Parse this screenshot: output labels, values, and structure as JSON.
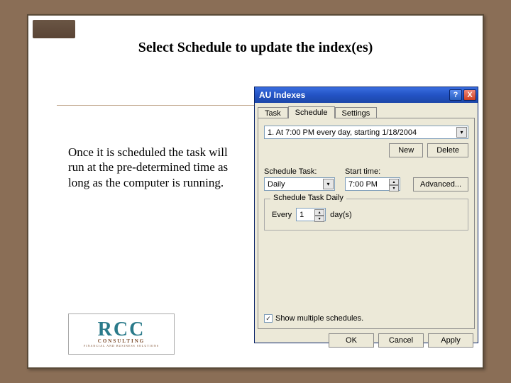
{
  "slide": {
    "title": "Select Schedule to update the index(es)",
    "description": "Once it is scheduled the task will run at the pre-determined time as long as the computer is running."
  },
  "logo": {
    "main": "RCC",
    "sub": "CONSULTING",
    "tag": "FINANCIAL AND BUSINESS SOLUTIONS"
  },
  "dialog": {
    "title": "AU Indexes",
    "titlebar": {
      "help": "?",
      "close": "X"
    },
    "tabs": {
      "task": "Task",
      "schedule": "Schedule",
      "settings": "Settings"
    },
    "schedule_entry": "1. At 7:00 PM every day, starting 1/18/2004",
    "buttons": {
      "new": "New",
      "delete": "Delete",
      "advanced": "Advanced...",
      "ok": "OK",
      "cancel": "Cancel",
      "apply": "Apply"
    },
    "labels": {
      "schedule_task": "Schedule Task:",
      "start_time": "Start time:",
      "group": "Schedule Task Daily",
      "every": "Every",
      "days": "day(s)",
      "show_multiple": "Show multiple schedules."
    },
    "values": {
      "schedule_task": "Daily",
      "start_time": "7:00 PM",
      "every": "1",
      "show_multiple_checked": "✓"
    }
  }
}
